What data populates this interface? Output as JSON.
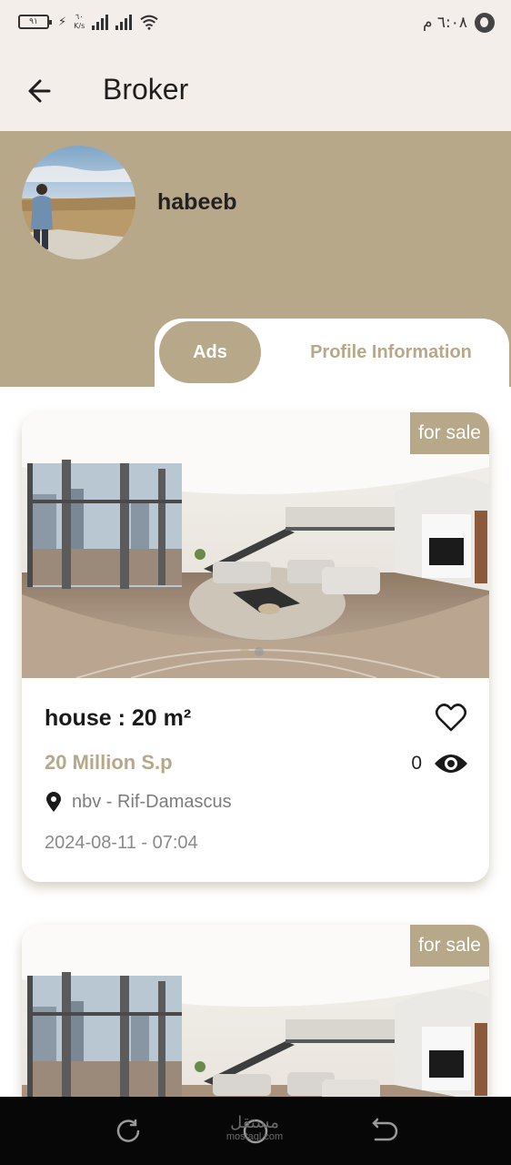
{
  "status_bar": {
    "battery": "٩١",
    "speed_top": "٦٠",
    "speed_unit": "K/s",
    "time": "٦:٠٨ م"
  },
  "app_bar": {
    "title": "Broker",
    "back_icon": "arrow-left-icon"
  },
  "profile": {
    "name": "habeeb",
    "avatar_icon": "avatar"
  },
  "tabs": [
    {
      "label": "Ads",
      "active": true
    },
    {
      "label": "Profile Information",
      "active": false
    }
  ],
  "ads": [
    {
      "badge": "for sale",
      "title": "house : 20 m²",
      "price": "20 Million S.p",
      "views": "0",
      "location": "nbv - Rif-Damascus",
      "date": "2024-08-11 - 07:04"
    },
    {
      "badge": "for sale"
    }
  ],
  "navigation": {
    "watermark_top": "مستقل",
    "watermark_bottom": "mostaql.com"
  },
  "colors": {
    "accent": "#b8a88a",
    "appbar_bg": "#f4eeea",
    "text_dark": "#1a1a1a",
    "text_muted": "#8a8a8a"
  }
}
